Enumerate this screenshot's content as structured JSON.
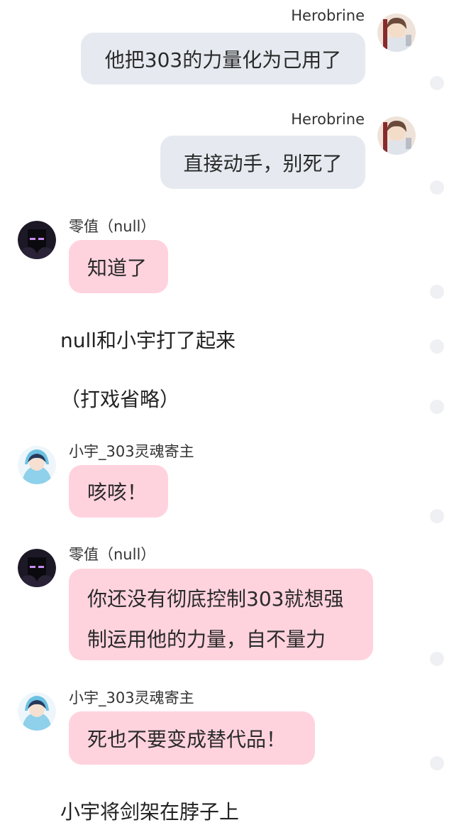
{
  "messages": [
    {
      "sender": "Herobrine",
      "text": "他把303的力量化为己用了"
    },
    {
      "sender": "Herobrine",
      "text": "直接动手，别死了"
    },
    {
      "sender": "零值（null）",
      "text": "知道了"
    },
    {
      "sender": "小宇_303灵魂寄主",
      "text": "咳咳！"
    },
    {
      "sender": "零值（null）",
      "lines": [
        "你还没有彻底控制303就想强",
        "制运用他的力量，自不量力"
      ]
    },
    {
      "sender": "小宇_303灵魂寄主",
      "text": "死也不要变成替代品！"
    }
  ],
  "narration": [
    "null和小宇打了起来",
    "（打戏省略）",
    "小宇将剑架在脖子上"
  ],
  "avatars": {
    "herobrine": "herobrine-avatar",
    "null": "null-enderman-avatar",
    "xiaoyu": "xiaoyu-blue-hoodie-avatar"
  },
  "colors": {
    "right_bubble": "#e6eaf0",
    "left_bubble": "#ffd3de",
    "side_dot": "#eef0f3"
  }
}
